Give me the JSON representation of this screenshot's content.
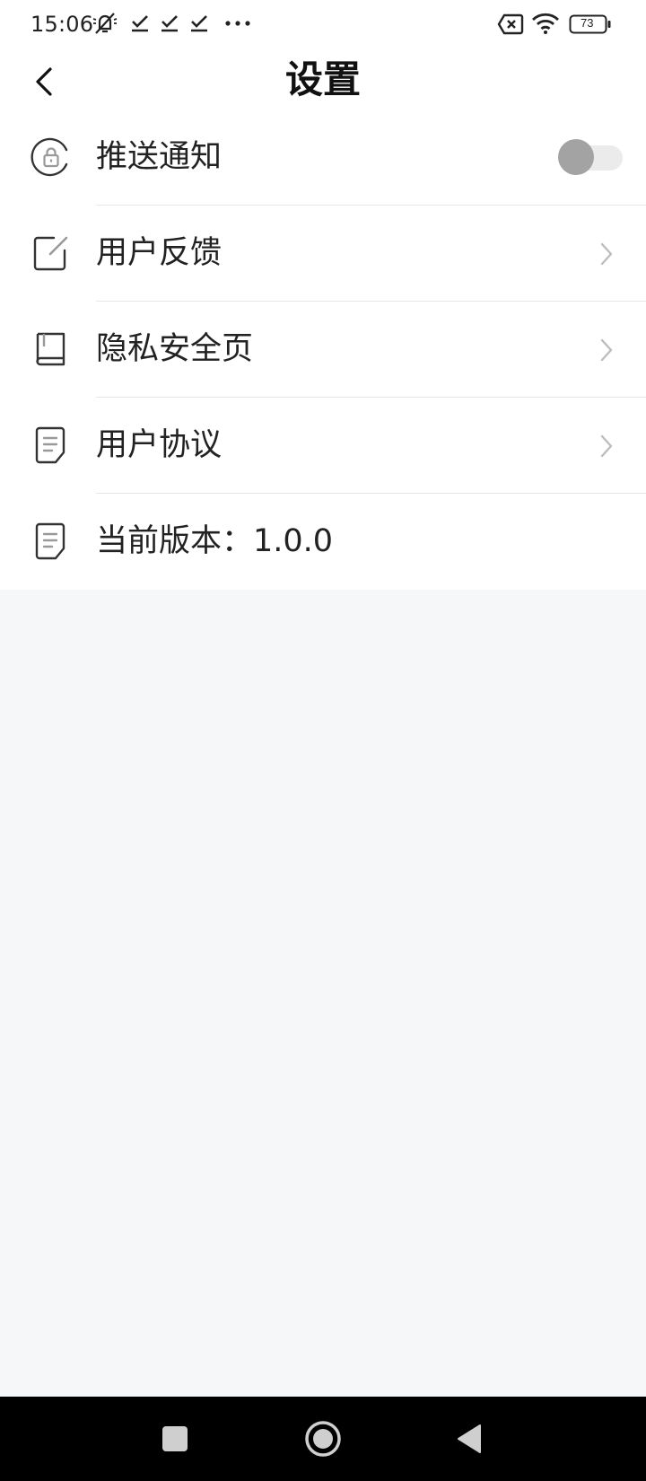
{
  "status_bar": {
    "time": "15:06",
    "battery_level": "73",
    "icons_left": [
      "mute-icon",
      "download-done-icon",
      "download-done-icon",
      "download-done-icon",
      "more-dots-icon"
    ],
    "icons_right": [
      "sim-off-icon",
      "wifi-icon",
      "battery-icon"
    ]
  },
  "header": {
    "title": "设置",
    "back_icon": "chevron-left-icon"
  },
  "settings": {
    "items": [
      {
        "label": "推送通知",
        "icon": "lock-circle-icon",
        "control": "toggle",
        "toggle_on": false
      },
      {
        "label": "用户反馈",
        "icon": "edit-square-icon",
        "control": "chevron"
      },
      {
        "label": "隐私安全页",
        "icon": "book-icon",
        "control": "chevron"
      },
      {
        "label": "用户协议",
        "icon": "document-icon",
        "control": "chevron"
      },
      {
        "label": "当前版本：1.0.0",
        "icon": "document-icon",
        "control": "none"
      }
    ]
  },
  "nav_bar": {
    "buttons": [
      "recents-square-icon",
      "home-circle-icon",
      "back-triangle-icon"
    ]
  },
  "colors": {
    "background": "#f6f7f9",
    "surface": "#ffffff",
    "divider": "#e6e6e6",
    "toggle_off_knob": "#a3a3a3",
    "toggle_off_track": "#ebebeb",
    "nav_bar": "#000000"
  }
}
